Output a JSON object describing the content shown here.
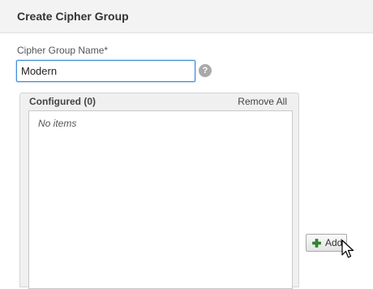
{
  "header": {
    "title": "Create Cipher Group"
  },
  "form": {
    "name_label": "Cipher Group Name*",
    "name_value": "Modern",
    "help_icon_glyph": "?"
  },
  "configured": {
    "title": "Configured",
    "count_text": "(0)",
    "remove_all_label": "Remove All",
    "empty_text": "No items"
  },
  "actions": {
    "add_label": "Add"
  },
  "icons": {
    "help": "question-circle-icon",
    "add": "plus-icon",
    "cursor": "mouse-pointer-icon"
  },
  "colors": {
    "header_bg": "#f3f3f3",
    "input_focus_border": "#3d8ad6",
    "plus_icon": "#2f8a2f",
    "help_icon_bg": "#a9a9a9"
  }
}
